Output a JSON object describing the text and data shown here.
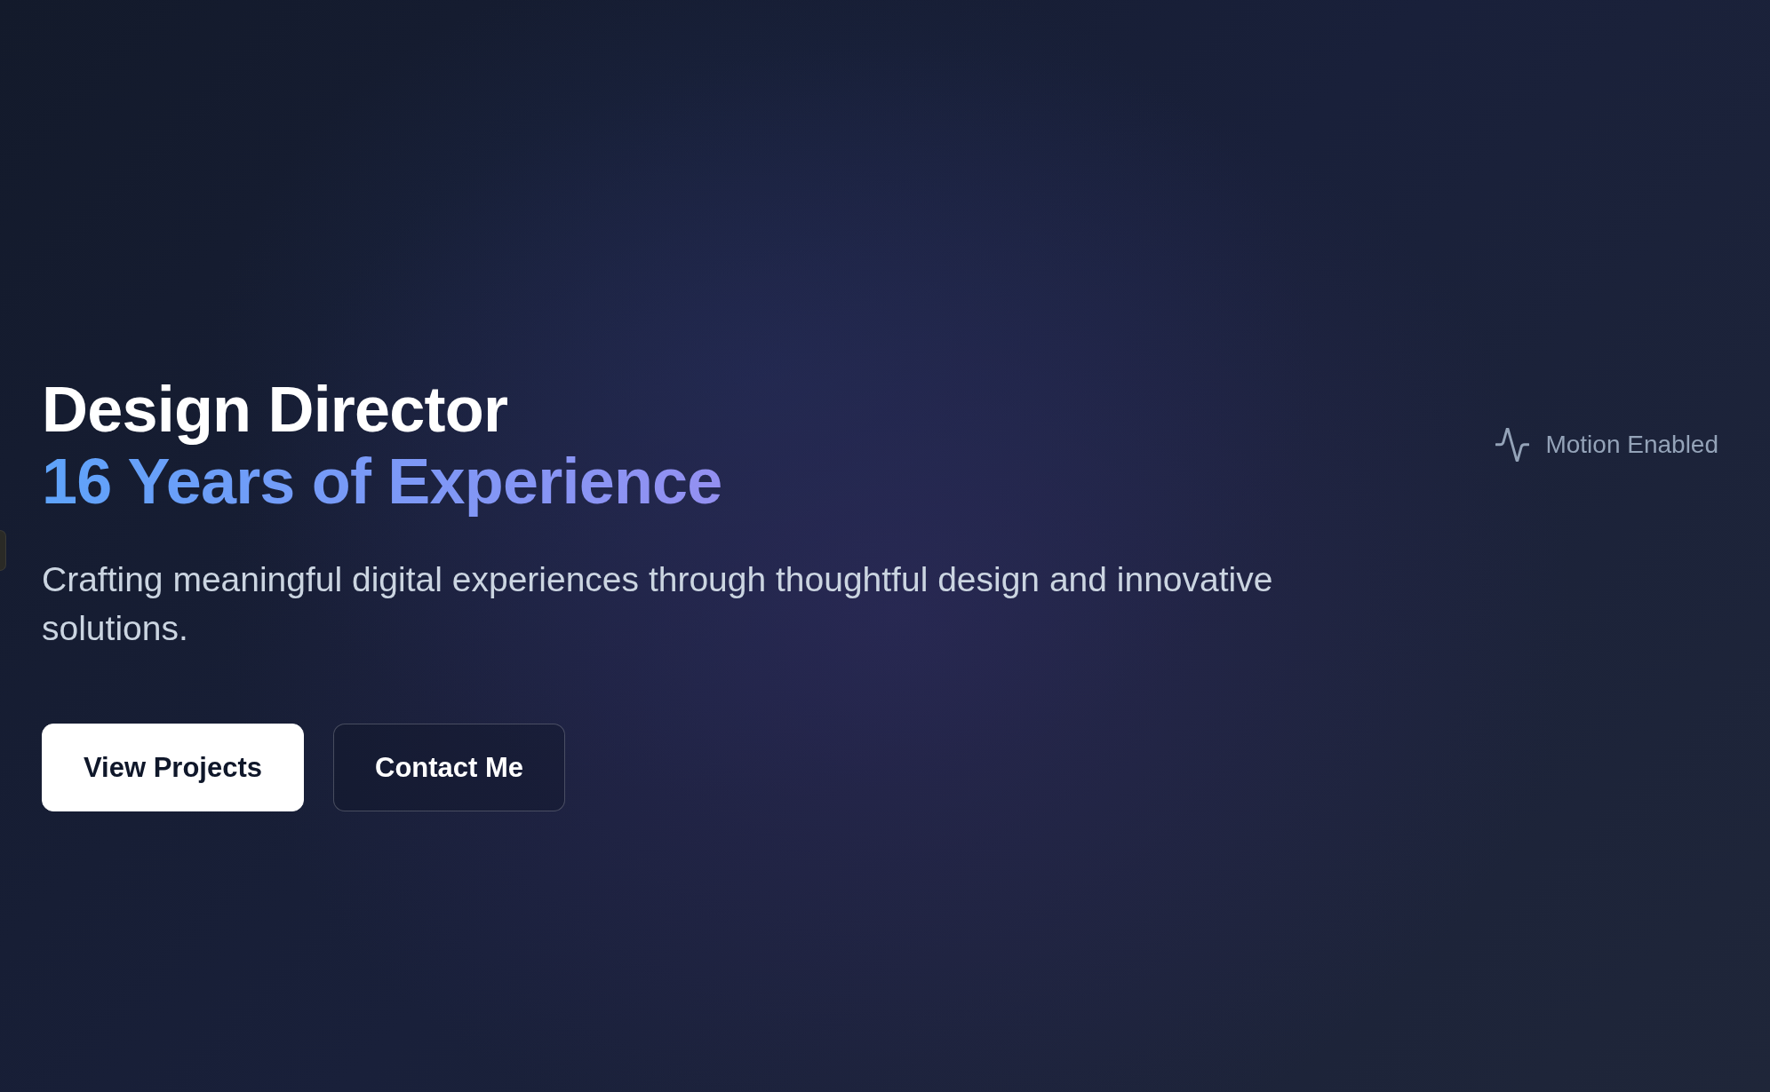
{
  "hero": {
    "title": "Design Director",
    "subtitle": "16 Years of Experience",
    "description": "Crafting meaningful digital experiences through thoughtful design and innovative solutions.",
    "buttons": [
      {
        "label": "View Projects",
        "kind": "primary"
      },
      {
        "label": "Contact Me",
        "kind": "outline"
      }
    ]
  },
  "motion_indicator": {
    "label": "Motion Enabled"
  }
}
